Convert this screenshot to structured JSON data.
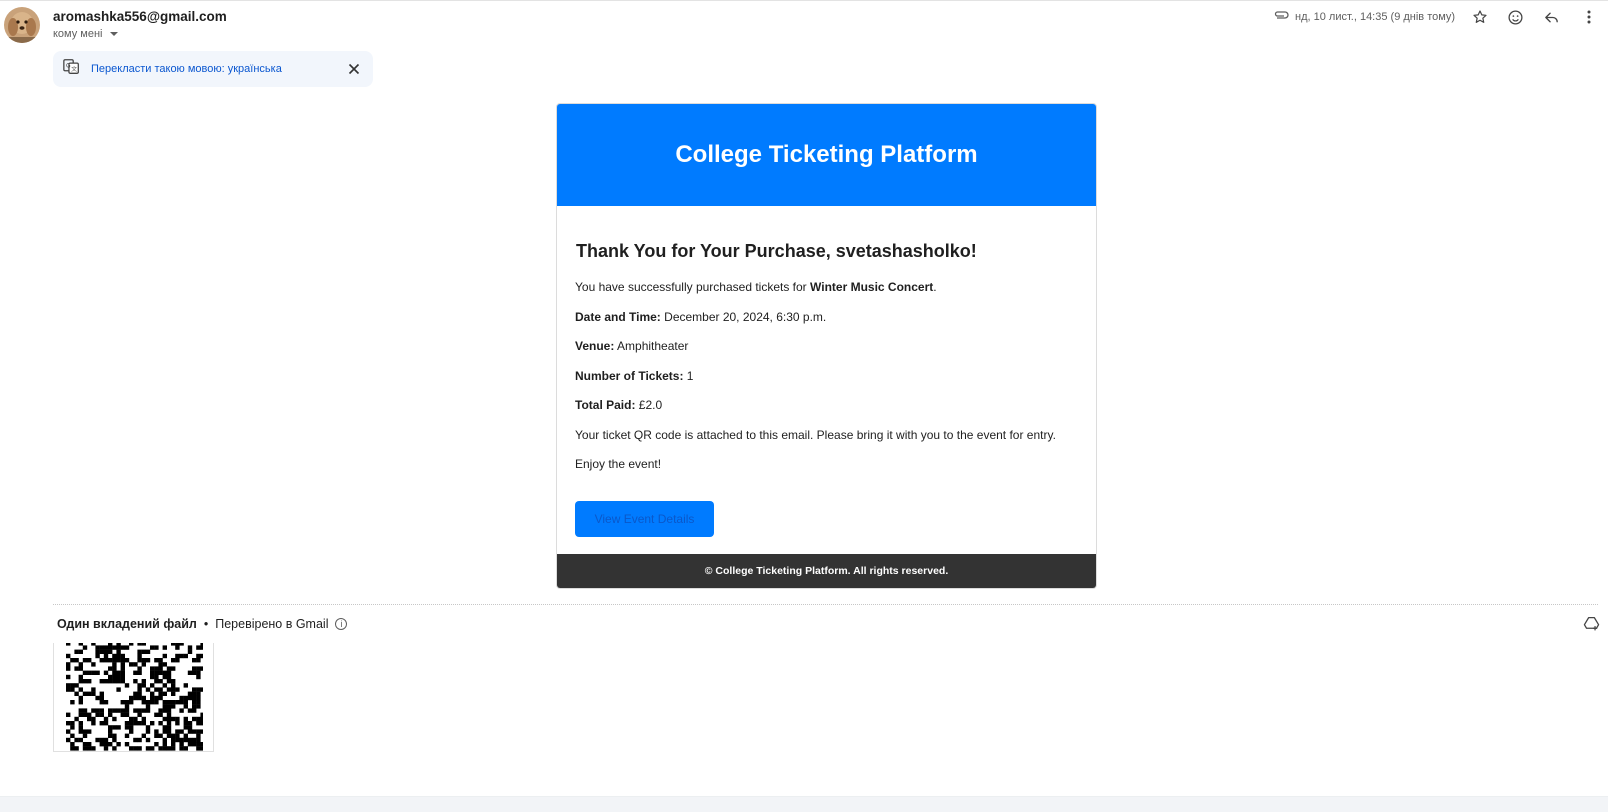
{
  "header": {
    "sender": "aromashka556@gmail.com",
    "recipient_label": "кому мені",
    "date_text": "нд, 10 лист., 14:35 (9 днів тому)",
    "icons": [
      "paperclip-icon",
      "star-icon",
      "emoji-icon",
      "reply-icon",
      "more-vert-icon"
    ]
  },
  "translate_bar": {
    "text": "Перекласти такою мовою: українська",
    "icon": "translate-icon",
    "close_icon": "close-icon"
  },
  "email": {
    "header_title": "College Ticketing Platform",
    "greeting": "Thank You for Your Purchase, svetashasholko!",
    "purchase_intro": "You have successfully purchased tickets for ",
    "event_name": "Winter Music Concert",
    "purchase_period": ".",
    "date_label": "Date and Time:",
    "date_value": " December 20, 2024, 6:30 p.m.",
    "venue_label": "Venue:",
    "venue_value": " Amphitheater",
    "tickets_label": "Number of Tickets:",
    "tickets_value": " 1",
    "total_label": "Total Paid:",
    "total_value": " £2.0",
    "qr_note": "Your ticket QR code is attached to this email. Please bring it with you to the event for entry.",
    "enjoy": "Enjoy the event!",
    "button_label": "View Event Details",
    "footer": "© College Ticketing Platform. All rights reserved.",
    "colors": {
      "brand": "#007bff",
      "footer_bg": "#333333"
    }
  },
  "attachments": {
    "title": "Один вкладений файл",
    "separator": "•",
    "scan_status": "Перевірено в Gmail",
    "drive_icon": "add-to-drive-icon"
  }
}
